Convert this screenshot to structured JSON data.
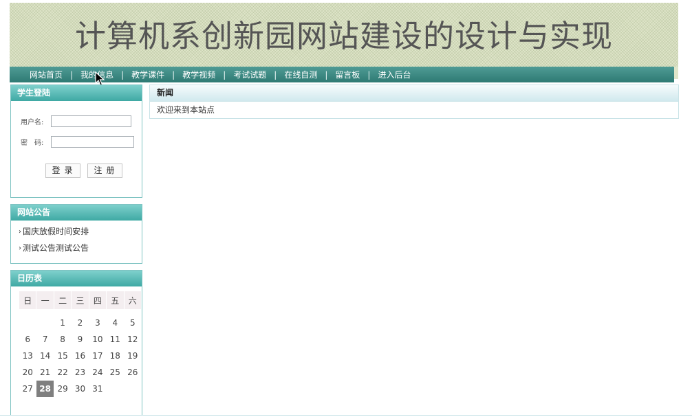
{
  "header": {
    "title": "计算机系创新园网站建设的设计与实现"
  },
  "nav": {
    "items": [
      {
        "label": "网站首页"
      },
      {
        "label": "我的信息"
      },
      {
        "label": "教学课件"
      },
      {
        "label": "教学视频"
      },
      {
        "label": "考试试题"
      },
      {
        "label": "在线自测"
      },
      {
        "label": "留言板"
      },
      {
        "label": "进入后台"
      }
    ],
    "separator": "|"
  },
  "login": {
    "title": "学生登陆",
    "username_label": "用户名:",
    "username_value": "",
    "password_label": "密　码:",
    "password_value": "",
    "login_button": "登录",
    "register_button": "注册"
  },
  "notice": {
    "title": "网站公告",
    "items": [
      "国庆放假时间安排",
      "测试公告测试公告"
    ]
  },
  "calendar": {
    "title": "日历表",
    "weekdays": [
      "日",
      "一",
      "二",
      "三",
      "四",
      "五",
      "六"
    ],
    "weeks": [
      [
        "",
        "",
        "1",
        "2",
        "3",
        "4",
        "5"
      ],
      [
        "6",
        "7",
        "8",
        "9",
        "10",
        "11",
        "12"
      ],
      [
        "13",
        "14",
        "15",
        "16",
        "17",
        "18",
        "19"
      ],
      [
        "20",
        "21",
        "22",
        "23",
        "24",
        "25",
        "26"
      ],
      [
        "27",
        "28",
        "29",
        "30",
        "31",
        "",
        ""
      ]
    ],
    "today": "28"
  },
  "news": {
    "title": "新闻",
    "body": "欢迎来到本站点"
  },
  "colors": {
    "nav_bg": "#3a8a84",
    "panel_head": "#4fb5b0",
    "today_bg": "#7f7f7f"
  }
}
